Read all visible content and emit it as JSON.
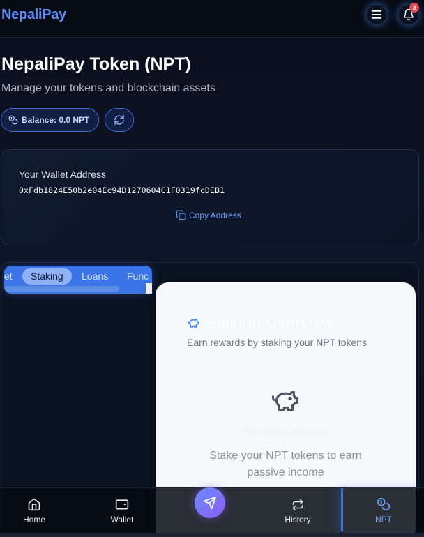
{
  "app": {
    "name": "NepaliPay",
    "notification_count": "3"
  },
  "header": {
    "menu_icon": "hamburger-menu-icon",
    "bell_icon": "bell-icon"
  },
  "hero": {
    "title": "NepaliPay Token (NPT)",
    "subtitle": "Manage your tokens and blockchain assets",
    "balance_label": "Balance: 0.0 NPT"
  },
  "wallet": {
    "label": "Your Wallet Address",
    "address": "0xFdb1824E50b2e04Ec94D1270604C1F0319fcDEB1",
    "copy_label": "Copy Address"
  },
  "tabs": {
    "items": [
      "et",
      "Staking",
      "Loans",
      "Func"
    ],
    "active": "Staking"
  },
  "staking": {
    "title": "Staking Overview",
    "subtitle": "Earn rewards by staking your NPT tokens",
    "empty_title": "No Active Staking",
    "empty_description": "Stake your NPT tokens to earn passive income"
  },
  "nav": {
    "home": "Home",
    "wallet": "Wallet",
    "history": "History",
    "npt": "NPT"
  },
  "colors": {
    "accent": "#3b74e8",
    "logo": "#5b8ef8",
    "background": "#0b1120",
    "badge": "#e5484d"
  }
}
